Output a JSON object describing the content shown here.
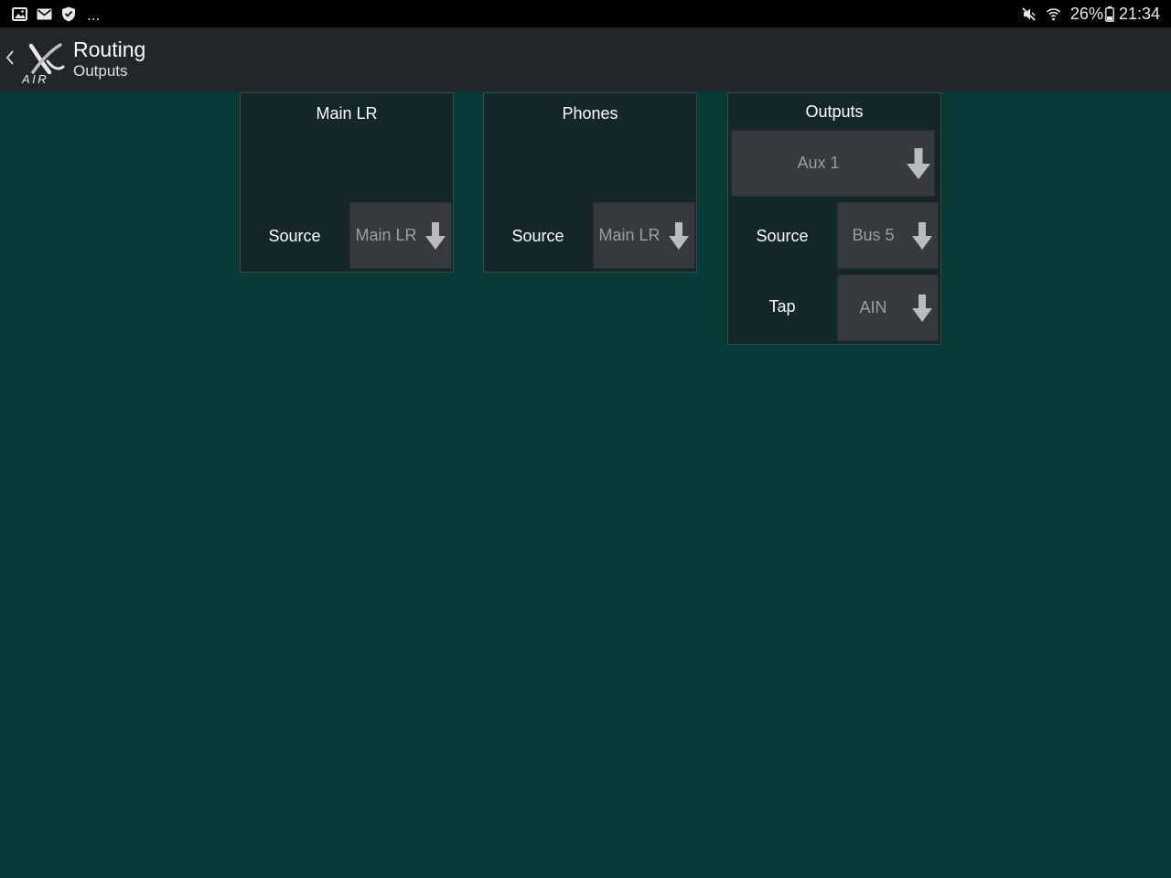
{
  "status_bar": {
    "left_icons": [
      "image-icon",
      "mail-icon",
      "shield-icon"
    ],
    "overflow": "...",
    "right_icons": [
      "mute-icon",
      "wifi-icon"
    ],
    "battery_text": "26%",
    "battery_icon": "battery-icon",
    "time": "21:34"
  },
  "app_bar": {
    "back_icon": "chevron-left-icon",
    "logo_text": "AIR",
    "title": "Routing",
    "subtitle": "Outputs"
  },
  "panels": {
    "main_lr": {
      "title": "Main LR",
      "source_label": "Source",
      "source_value": "Main LR"
    },
    "phones": {
      "title": "Phones",
      "source_label": "Source",
      "source_value": "Main LR"
    },
    "outputs": {
      "title": "Outputs",
      "output_select": "Aux 1",
      "source_label": "Source",
      "source_value": "Bus 5",
      "tap_label": "Tap",
      "tap_value": "AIN"
    }
  },
  "colors": {
    "background": "#083a38",
    "panel": "#13272a",
    "button": "#373a3d",
    "button_text": "#9a9ea2",
    "appbar": "#232628"
  }
}
